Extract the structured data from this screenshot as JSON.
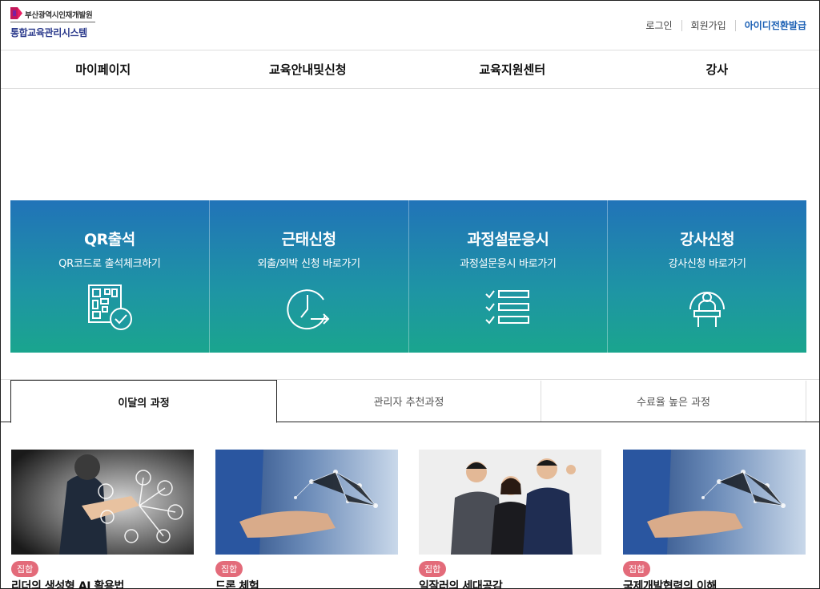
{
  "header": {
    "logo_org": "부산광역시인재개발원",
    "logo_system": "통합교육관리시스템",
    "util_links": [
      "로그인",
      "회원가입",
      "아이디전환발급"
    ]
  },
  "nav": [
    "마이페이지",
    "교육안내및신청",
    "교육지원센터",
    "강사"
  ],
  "tiles": [
    {
      "title": "QR출석",
      "subtitle": "QR코드로 출석체크하기",
      "icon": "qr-check-icon"
    },
    {
      "title": "근태신청",
      "subtitle": "외출/외박 신청 바로가기",
      "icon": "clock-arrow-icon"
    },
    {
      "title": "과정설문응시",
      "subtitle": "과정설문응시 바로가기",
      "icon": "checklist-icon"
    },
    {
      "title": "강사신청",
      "subtitle": "강사신청 바로가기",
      "icon": "lecturer-icon"
    }
  ],
  "tabs": [
    "이달의 과정",
    "관리자 추천과정",
    "수료율 높은 과정"
  ],
  "cards": [
    {
      "badge": "집합",
      "title": "리더의 생성형 AI 활용법"
    },
    {
      "badge": "집합",
      "title": "드론 체험"
    },
    {
      "badge": "집합",
      "title": "일잘러의 세대공감"
    },
    {
      "badge": "집합",
      "title": "국제개발협력의 이해"
    }
  ],
  "colors": {
    "accent": "#1a5fb4",
    "tile_top": "#2173b8",
    "tile_bottom": "#1aa58e",
    "badge": "#e36b7a"
  }
}
